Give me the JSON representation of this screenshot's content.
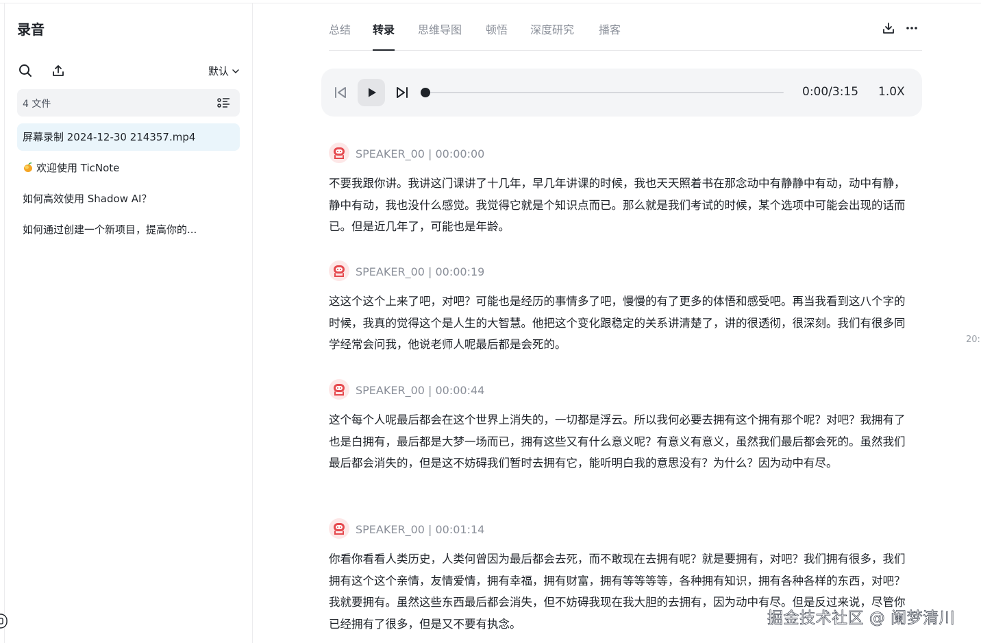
{
  "sidebar": {
    "title": "录音",
    "sort_label": "默认",
    "file_count": "4 文件",
    "files": [
      {
        "label": "屏幕录制 2024-12-30 214357.mp4"
      },
      {
        "label": "欢迎使用 TicNote"
      },
      {
        "label": "如何高效使用 Shadow AI？"
      },
      {
        "label": "如何通过创建一个新项目，提高你的..."
      }
    ]
  },
  "tabs": [
    {
      "label": "总结"
    },
    {
      "label": "转录"
    },
    {
      "label": "思维导图"
    },
    {
      "label": "顿悟"
    },
    {
      "label": "深度研究"
    },
    {
      "label": "播客"
    }
  ],
  "active_tab": "转录",
  "player": {
    "time": "0:00/3:15",
    "speed": "1.0X",
    "progress": 0
  },
  "segments": [
    {
      "speaker": "SPEAKER_00 | 00:00:00",
      "text": "不要我跟你讲。我讲这门课讲了十几年，早几年讲课的时候，我也天天照着书在那念动中有静静中有动，动中有静，静中有动，我也没什么感觉。我觉得它就是个知识点而已。那么就是我们考试的时候，某个选项中可能会出现的话而已。但是近几年了，可能也是年龄。"
    },
    {
      "speaker": "SPEAKER_00 | 00:00:19",
      "text": "这这个这个上来了吧，对吧？可能也是经历的事情多了吧，慢慢的有了更多的体悟和感受吧。再当我看到这八个字的时候，我真的觉得这个是人生的大智慧。他把这个变化跟稳定的关系讲清楚了，讲的很透彻，很深刻。我们有很多同学经常会问我，他说老师人呢最后都是会死的。"
    },
    {
      "speaker": "SPEAKER_00 | 00:00:44",
      "text": "这个每个人呢最后都会在这个世界上消失的，一切都是浮云。所以我何必要去拥有这个拥有那个呢？对吧？我拥有了也是白拥有，最后都是大梦一场而已，拥有这些又有什么意义呢？有意义有意义，虽然我们最后都会死的。虽然我们最后都会消失的，但是这不妨碍我们暂时去拥有它，能听明白我的意思没有？为什么？因为动中有尽。"
    },
    {
      "speaker": "SPEAKER_00 | 00:01:14",
      "text": "你看你看看人类历史，人类何曾因为最后都会去死，而不敢现在去拥有呢？就是要拥有，对吧？我们拥有很多，我们拥有这个这个亲情，友情爱情，拥有幸福，拥有财富，拥有等等等等，各种拥有知识，拥有各种各样的东西，对吧？我就要拥有。虽然这些东西最后都会消失，但不妨碍我现在我大胆的去拥有，因为动中有尽。但是反过来说，尽管你已经拥有了很多，但是又不要有执念。"
    }
  ],
  "side_note": "20:",
  "watermark": "掘金技术社区 @ 阑梦清川",
  "icons": {
    "search": "search-icon",
    "upload": "upload-icon",
    "chevron": "chevron-down-icon",
    "list": "list-view-icon",
    "download": "download-icon",
    "more": "more-icon",
    "prev": "skip-back-icon",
    "play": "play-icon",
    "next": "skip-next-icon",
    "avatar": "speaker-avatar-icon"
  },
  "colors": {
    "active_file_bg": "#eaf5fb",
    "avatar_red": "#e5484d"
  }
}
